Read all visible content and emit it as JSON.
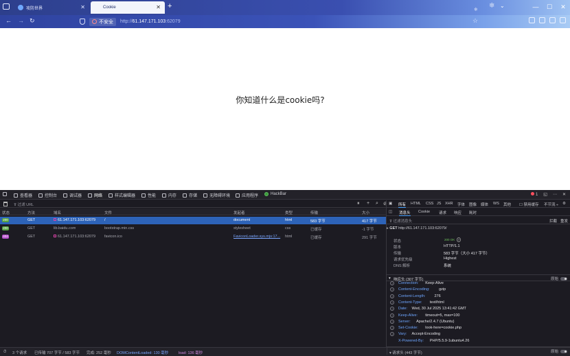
{
  "browser": {
    "tabs": [
      {
        "label": "攻防世界",
        "active": false
      },
      {
        "label": "Cookie",
        "active": true
      }
    ],
    "security_label": "不安全",
    "url": {
      "scheme": "http://",
      "host": "61.147.171.103",
      "port": ":62079"
    }
  },
  "page": {
    "question": "你知道什么是cookie吗?"
  },
  "devtools": {
    "tabs": [
      {
        "label": "查看器",
        "icon": "inspector-icon"
      },
      {
        "label": "控制台",
        "icon": "console-icon"
      },
      {
        "label": "调试器",
        "icon": "debugger-icon"
      },
      {
        "label": "网络",
        "icon": "network-icon",
        "active": true
      },
      {
        "label": "样式编辑器",
        "icon": "style-editor-icon"
      },
      {
        "label": "性能",
        "icon": "performance-icon"
      },
      {
        "label": "内存",
        "icon": "memory-icon"
      },
      {
        "label": "存储",
        "icon": "storage-icon"
      },
      {
        "label": "无障碍环境",
        "icon": "accessibility-icon"
      },
      {
        "label": "应用程序",
        "icon": "application-icon"
      },
      {
        "label": "HackBar",
        "icon": "hackbar-icon"
      }
    ],
    "error_count": "1",
    "filter_placeholder": "过滤 URL",
    "network": {
      "columns": [
        "状态",
        "方法",
        "域名",
        "文件",
        "发起者",
        "类型",
        "传输",
        "大小"
      ],
      "rows": [
        {
          "status": "200",
          "method": "GET",
          "domain": "61.147.171.103:62079",
          "file": "/",
          "initiator": "document",
          "type": "html",
          "transfer": "583 字节",
          "size": "417 字节",
          "selected": true
        },
        {
          "status": "200",
          "method": "GET",
          "domain": "lib.baidu.com",
          "file": "bootstrap.min.css",
          "initiator": "stylesheet",
          "type": "css",
          "transfer": "已缓存",
          "size": "-1 字节",
          "selected": false
        },
        {
          "status": "404",
          "method": "GET",
          "domain": "61.147.171.103:62079",
          "file": "favicon.ico",
          "initiator": "FaviconLoader.sys.mjs:17...",
          "type": "html",
          "transfer": "已缓存",
          "size": "291 字节",
          "selected": false
        }
      ]
    },
    "side": {
      "tabs": [
        "消息头",
        "Cookie",
        "请求",
        "响应",
        "耗时"
      ],
      "filter_types": [
        "所有",
        "HTML",
        "CSS",
        "JS",
        "XHR",
        "字体",
        "图像",
        "媒体",
        "WS",
        "其他"
      ],
      "disable_cache": "禁用缓存",
      "throttle": "不节流 ÷",
      "filter_headers": "过滤消息头",
      "block": "拦截",
      "resend": "重发",
      "request_line": {
        "method": "GET",
        "url": "http://61.147.171.103:62079/"
      },
      "summary": [
        {
          "key": "状态",
          "value": "200 OK"
        },
        {
          "key": "版本",
          "value": "HTTP/1.1"
        },
        {
          "key": "传输",
          "value": "583 字节（大小 417 字节）"
        },
        {
          "key": "请求优先级",
          "value": "Highest"
        },
        {
          "key": "DNS 解析",
          "value": "系统"
        }
      ],
      "response_headers_title": "响应头 (307 字节)",
      "raw_label": "原始",
      "response_headers": [
        {
          "key": "Connection:",
          "value": "Keep-Alive"
        },
        {
          "key": "Content-Encoding:",
          "value": "gzip"
        },
        {
          "key": "Content-Length:",
          "value": "276"
        },
        {
          "key": "Content-Type:",
          "value": "text/html"
        },
        {
          "key": "Date:",
          "value": "Wed, 30 Jul 2025 13:41:42 GMT"
        },
        {
          "key": "Keep-Alive:",
          "value": "timeout=5, max=100"
        },
        {
          "key": "Server:",
          "value": "Apache/2.4.7 (Ubuntu)"
        },
        {
          "key": "Set-Cookie:",
          "value": "look-here=cookie.php"
        },
        {
          "key": "Vary:",
          "value": "Accept-Encoding"
        },
        {
          "key": "X-Powered-By:",
          "value": "PHP/5.5.9-1ubuntu4.26"
        }
      ],
      "request_headers_title": "请求头 (443 字节)"
    },
    "statusbar": {
      "requests": "3 个请求",
      "transferred": "已传输 707 字节 / 583 字节",
      "finish": "完成: 252 毫秒",
      "dom": "DOMContentLoaded: 130 毫秒",
      "load": "load: 136 毫秒"
    }
  }
}
